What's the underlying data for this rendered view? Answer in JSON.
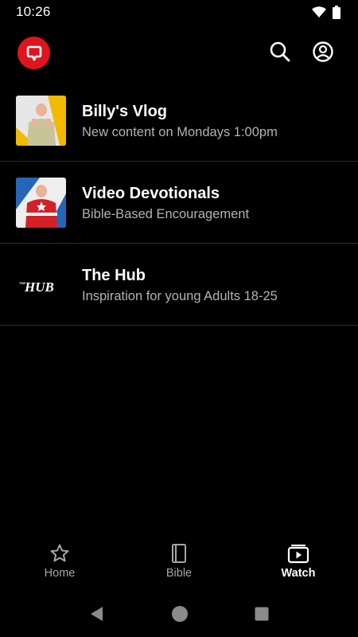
{
  "status_bar": {
    "time": "10:26"
  },
  "app_bar": {
    "logo_icon": "chat-bubble-logo",
    "search_icon": "search-icon",
    "account_icon": "account-circle-icon",
    "brand_color": "#e0141e"
  },
  "list": {
    "items": [
      {
        "title": "Billy's Vlog",
        "subtitle": "New content on Mondays 1:00pm"
      },
      {
        "title": "Video Devotionals",
        "subtitle": "Bible-Based Encouragement"
      },
      {
        "title": "The Hub",
        "subtitle": "Inspiration for young Adults 18-25",
        "thumb_text": "THE HUB"
      }
    ]
  },
  "bottom_nav": {
    "items": [
      {
        "label": "Home",
        "icon": "star-icon"
      },
      {
        "label": "Bible",
        "icon": "book-icon"
      },
      {
        "label": "Watch",
        "icon": "video-library-icon",
        "active": true
      }
    ]
  },
  "colors": {
    "background": "#000000",
    "active_text": "#ffffff",
    "inactive_text": "#a6a6a6",
    "divider": "#2b2b2b"
  }
}
